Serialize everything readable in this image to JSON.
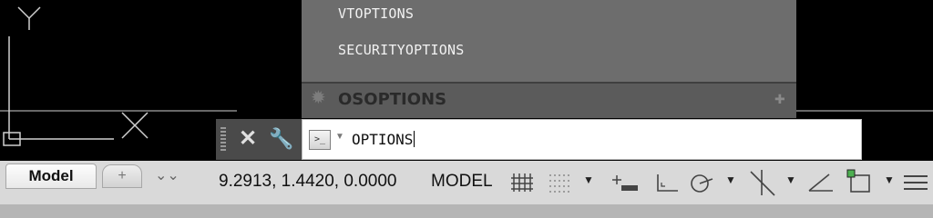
{
  "autocomplete": {
    "items": [
      "VTOPTIONS",
      "SECURITYOPTIONS"
    ],
    "highlighted": "OSOPTIONS",
    "highlighted_icon": "gear-icon",
    "pin_icon": "pin-icon"
  },
  "command_line": {
    "close_icon": "close-icon",
    "customize_icon": "wrench-icon",
    "prompt_symbol": ">_",
    "input_value": "OPTIONS",
    "history_arrow": "▲"
  },
  "status_bar": {
    "tabs": [
      {
        "label": "Model",
        "active": true
      },
      {
        "label": "+",
        "active": false
      }
    ],
    "more_tabs_icon": "double-chevron-down-icon",
    "coordinates": "9.2913, 1.4420, 0.0000",
    "space_label": "MODEL",
    "tools": [
      "grid-icon",
      "snap-icon",
      "infer-constraints-icon",
      "ortho-icon",
      "polar-icon",
      "isodraft-icon",
      "osnap-angle-icon",
      "workspace-icon",
      "customize-icon"
    ]
  },
  "colors": {
    "canvas": "#000000",
    "popup": "#6d6d6d",
    "popup_highlight": "#5b5b5b",
    "cmd_gray": "#4a4a4a",
    "status": "#d9d9d9"
  }
}
